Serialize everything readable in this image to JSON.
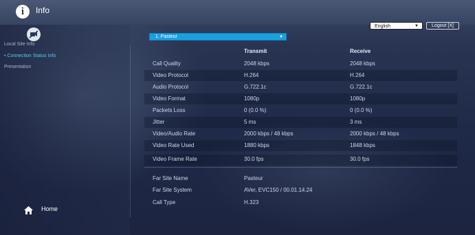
{
  "header": {
    "title": "Info",
    "language": "English",
    "logout_label": "Logout [X]",
    "info_icon": "info-icon"
  },
  "sidebar": {
    "camera_icon": "camera-off-icon",
    "items": [
      {
        "label": "Local Site Info",
        "active": false
      },
      {
        "label": "• Connection Status Info",
        "active": true
      },
      {
        "label": "Presentation",
        "active": false
      }
    ],
    "home_label": "Home",
    "home_icon": "home-icon"
  },
  "main": {
    "site_selector": "1. Pasteur",
    "columns": {
      "transmit": "Transmit",
      "receive": "Receive"
    },
    "rows": [
      {
        "label": "Call Quality",
        "transmit": "2048 kbps",
        "receive": "2048 kbps"
      },
      {
        "label": "Video Protocol",
        "transmit": "H.264",
        "receive": "H.264"
      },
      {
        "label": "Audio Protocol",
        "transmit": "G.722.1c",
        "receive": "G.722.1c"
      },
      {
        "label": "Video Format",
        "transmit": "1080p",
        "receive": "1080p"
      },
      {
        "label": "Packets Loss",
        "transmit": "0 (0.0 %)",
        "receive": "0 (0.0 %)"
      },
      {
        "label": "Jitter",
        "transmit": "5 ms",
        "receive": "3 ms"
      },
      {
        "label": "Video/Audio Rate",
        "transmit": "2000 kbps / 48 kbps",
        "receive": "2000 kbps / 48 kbps"
      },
      {
        "label": "Video Rate Used",
        "transmit": "1880 kbps",
        "receive": "1848 kbps"
      },
      {
        "label": "Video Frame Rate",
        "transmit": "30.0 fps",
        "receive": "30.0 fps"
      }
    ],
    "far_site": [
      {
        "label": "Far Site Name",
        "value": "Pasteur"
      },
      {
        "label": "Far Site System",
        "value": "AVer, EVC150 / 00.01.14.24"
      },
      {
        "label": "Call Type",
        "value": "H.323"
      }
    ]
  },
  "colors": {
    "accent": "#1aa0e0",
    "active_link": "#5ac8f0",
    "background": "#1f2a48"
  }
}
